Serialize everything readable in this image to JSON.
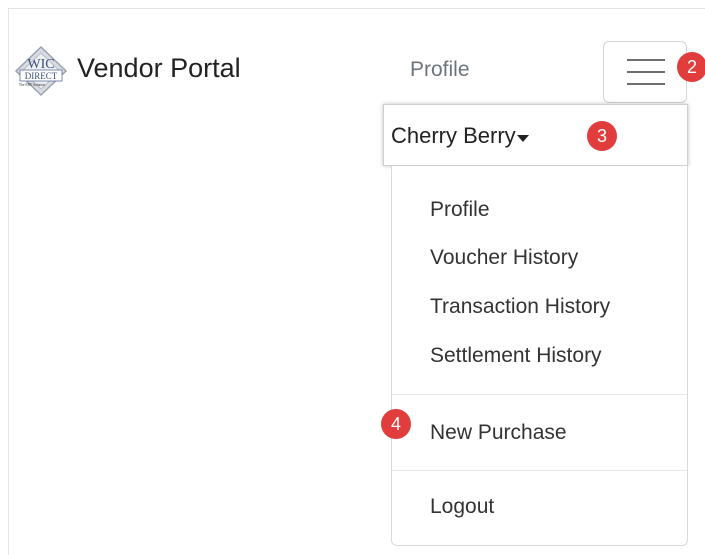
{
  "brand": {
    "logo_text_top": "WIC",
    "logo_text_mid": "DIRECT",
    "logo_text_tag": "The EBT Solution",
    "title": "Vendor Portal"
  },
  "nav": {
    "profile_label": "Profile"
  },
  "badges": {
    "toggle": "2",
    "user": "3",
    "new_purchase": "4"
  },
  "user_menu": {
    "name": "Cherry Berry"
  },
  "dropdown": {
    "items": [
      {
        "label": "Profile"
      },
      {
        "label": "Voucher History"
      },
      {
        "label": "Transaction History"
      },
      {
        "label": "Settlement History"
      }
    ],
    "new_purchase": "New Purchase",
    "logout": "Logout"
  },
  "colors": {
    "badge": "#e23d3d",
    "text": "#212529",
    "muted": "#6c757d",
    "border": "#d9d9d9"
  }
}
